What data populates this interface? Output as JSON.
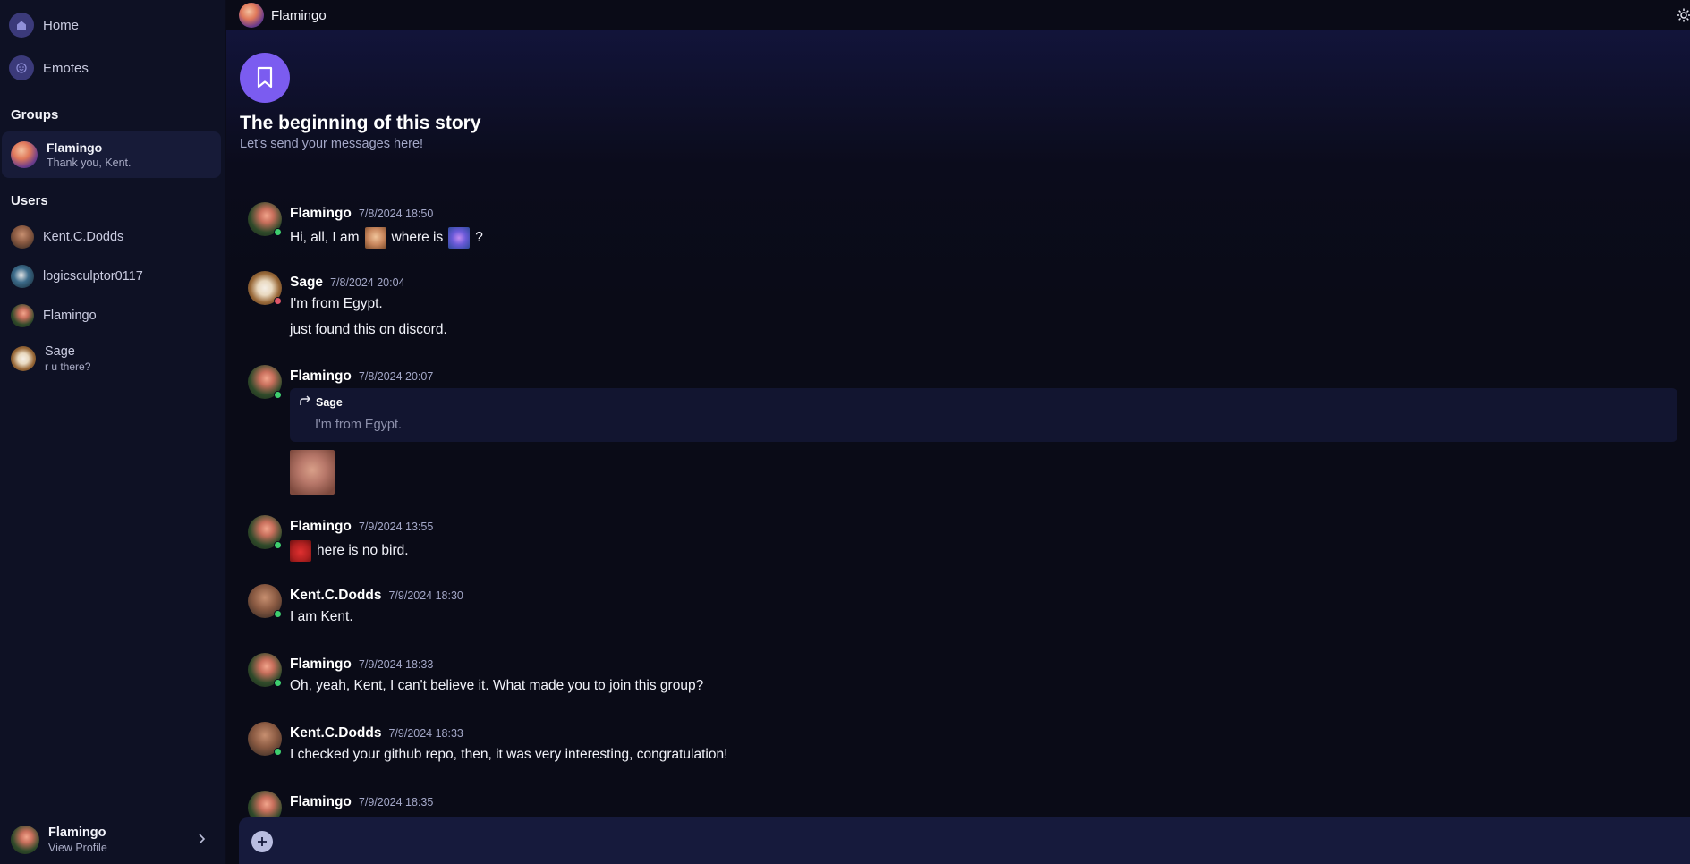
{
  "sidebar": {
    "nav": [
      {
        "label": "Home",
        "icon": "home-icon"
      },
      {
        "label": "Emotes",
        "icon": "smile-icon"
      }
    ],
    "groups_title": "Groups",
    "groups": [
      {
        "name": "Flamingo",
        "last_message": "Thank you, Kent."
      }
    ],
    "users_title": "Users",
    "users": [
      {
        "name": "Kent.C.Dodds",
        "subtitle": ""
      },
      {
        "name": "logicsculptor0117",
        "subtitle": ""
      },
      {
        "name": "Flamingo",
        "subtitle": ""
      },
      {
        "name": "Sage",
        "subtitle": "r u there?"
      }
    ],
    "profile": {
      "name": "Flamingo",
      "action": "View Profile"
    }
  },
  "header": {
    "title": "Flamingo"
  },
  "chat": {
    "intro_title": "The beginning of this story",
    "intro_subtitle": "Let's send your messages here!",
    "messages": [
      {
        "author": "Flamingo",
        "time": "7/8/2024 18:50",
        "status": "online",
        "text_parts": [
          "Hi, all, I am",
          "where is",
          "?"
        ]
      },
      {
        "author": "Sage",
        "time": "7/8/2024 20:04",
        "status": "offline",
        "lines": [
          "I'm from Egypt.",
          "just found this on discord."
        ]
      },
      {
        "author": "Flamingo",
        "time": "7/8/2024 20:07",
        "status": "online",
        "reply": {
          "author": "Sage",
          "text": "I'm from Egypt."
        }
      },
      {
        "author": "Flamingo",
        "time": "7/9/2024 13:55",
        "status": "online",
        "text": "here is no bird."
      },
      {
        "author": "Kent.C.Dodds",
        "time": "7/9/2024 18:30",
        "status": "online",
        "text": "I am Kent."
      },
      {
        "author": "Flamingo",
        "time": "7/9/2024 18:33",
        "status": "online",
        "text": "Oh, yeah, Kent, I can't believe it. What made you to join this group?"
      },
      {
        "author": "Kent.C.Dodds",
        "time": "7/9/2024 18:33",
        "status": "online",
        "text": "I checked your github repo, then, it was very interesting, congratulation!"
      },
      {
        "author": "Flamingo",
        "time": "7/9/2024 18:35",
        "status": "online",
        "text": ""
      }
    ]
  },
  "composer": {
    "placeholder": ""
  },
  "colors": {
    "accent": "#7b5cf0",
    "online": "#3ecf6e",
    "offline": "#e05668",
    "sidebar_bg": "#0e1124",
    "main_bg": "#0a0b17"
  }
}
